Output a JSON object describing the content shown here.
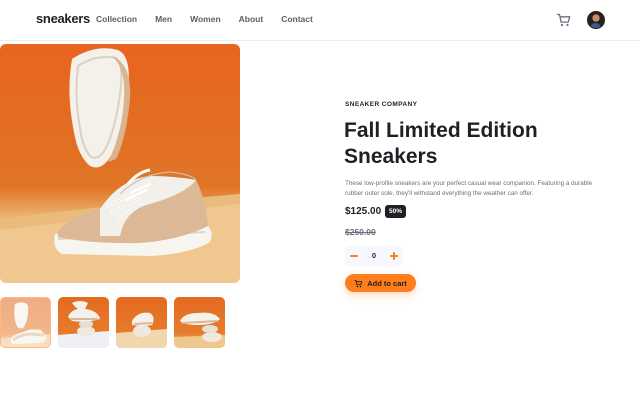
{
  "header": {
    "logo": "sneakers",
    "nav": [
      "Collection",
      "Men",
      "Women",
      "About",
      "Contact"
    ],
    "cart_icon": "cart-icon",
    "avatar_icon": "avatar"
  },
  "gallery": {
    "thumbnail_count": 4,
    "active_thumbnail": 1
  },
  "product": {
    "company": "SNEAKER COMPANY",
    "title": "Fall Limited Edition Sneakers",
    "description": "These low-profile sneakers are your perfect casual wear companion. Featuring a durable rubber outer sole, they'll withstand everything the weather can offer.",
    "price": "$125.00",
    "discount": "50%",
    "old_price": "$250.00"
  },
  "quantity": {
    "minus_icon": "minus-icon",
    "value": "0",
    "plus_icon": "plus-icon"
  },
  "add_to_cart": {
    "label": "Add to cart",
    "icon": "cart-icon"
  },
  "colors": {
    "accent": "#ff7d1a",
    "dark": "#1d2025",
    "muted": "#69707d",
    "background": "#ffffff"
  }
}
